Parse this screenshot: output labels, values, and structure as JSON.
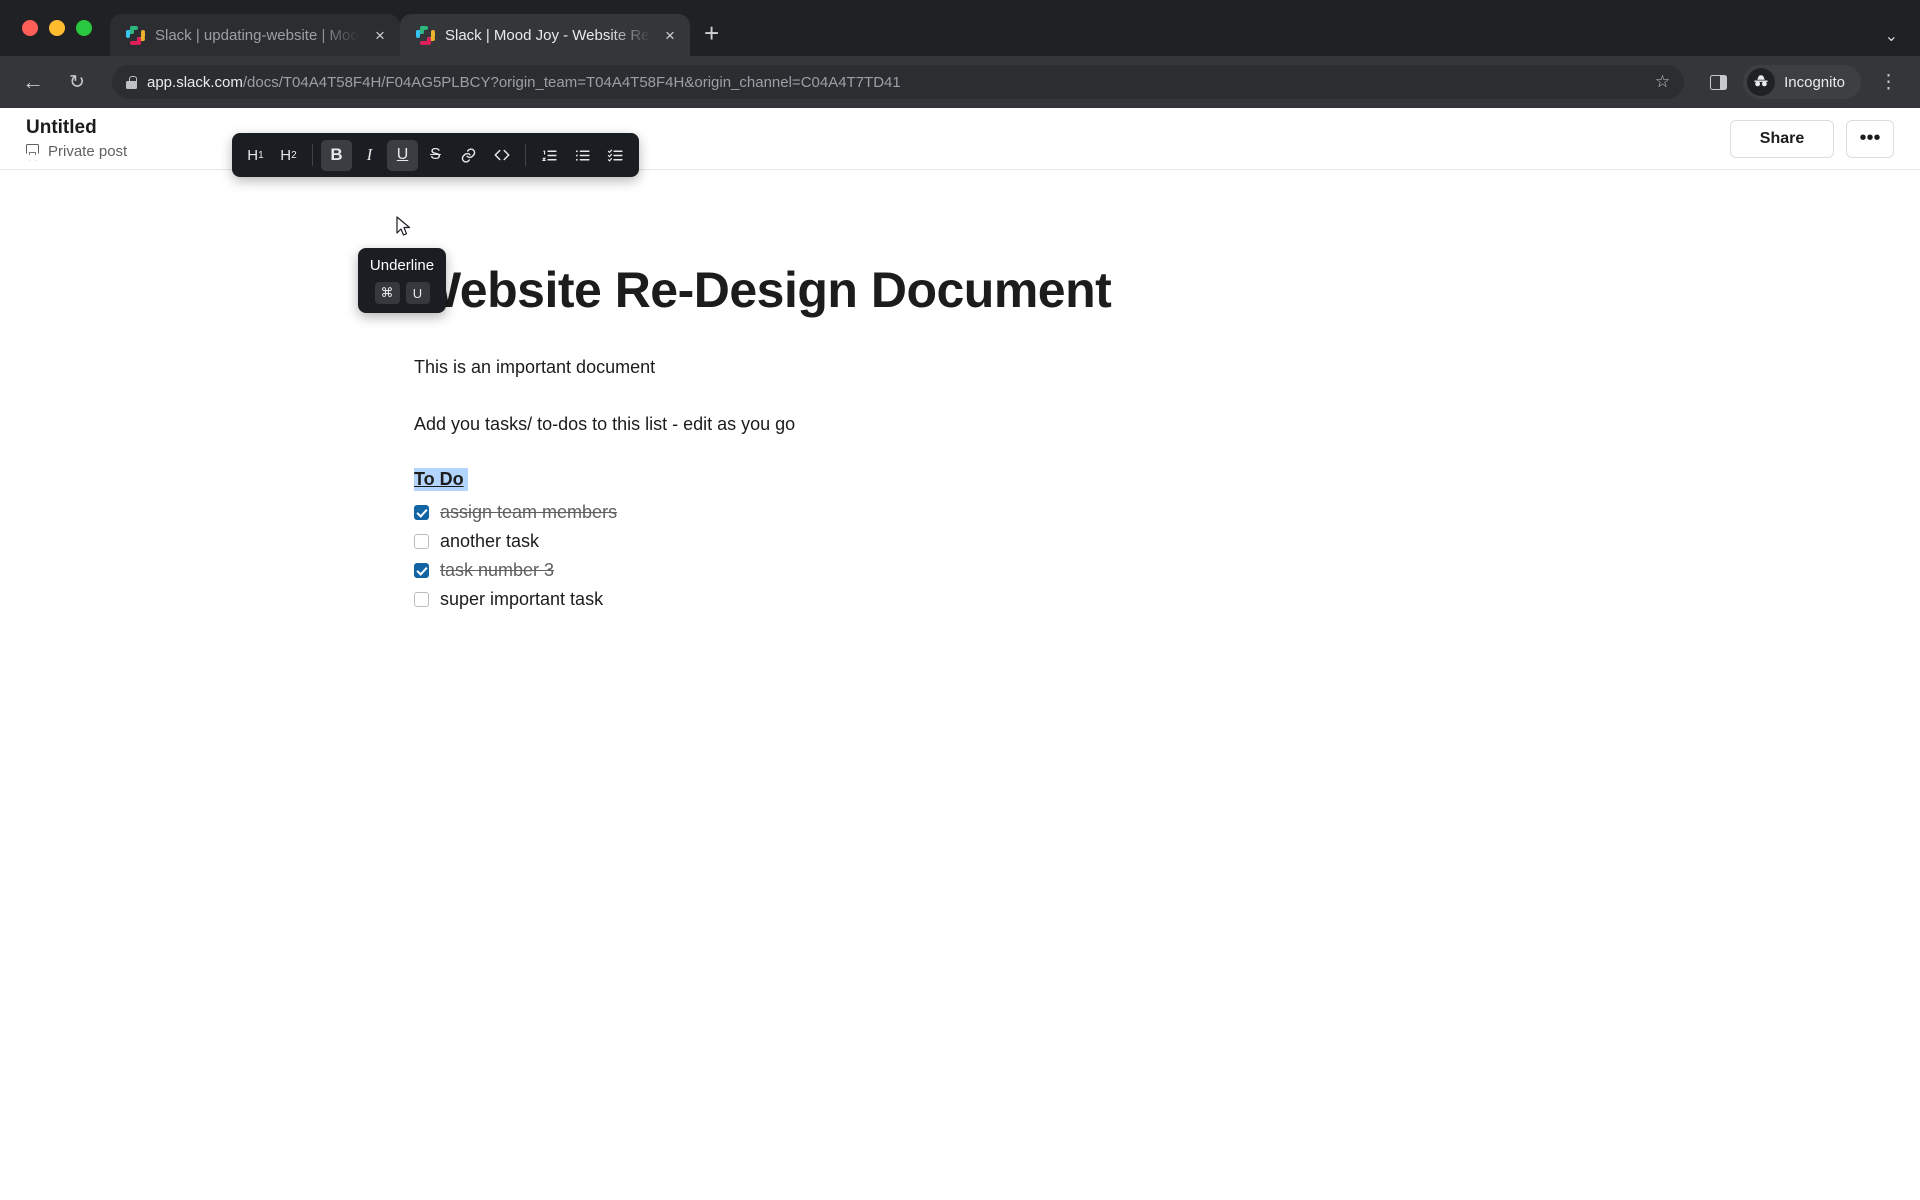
{
  "browser": {
    "tabs": [
      {
        "title": "Slack | updating-website | Mood Joy",
        "active": false,
        "icon": "slack-icon",
        "close_label": "×"
      },
      {
        "title": "Slack | Mood Joy - Website Re-Design Document",
        "active": true,
        "icon": "slack-icon",
        "close_label": "×"
      }
    ],
    "new_tab_label": "+",
    "tab_list_chevron": "⌄",
    "nav": {
      "back": "←",
      "forward": "→",
      "reload": "↻"
    },
    "omnibox": {
      "lock_icon": "lock-icon",
      "url_host": "app.slack.com",
      "url_rest": "/docs/T04A4T58F4H/F04AG5PLBCY?origin_team=T04A4T58F4H&origin_channel=C04A4T7TD41",
      "bookmark_star": "☆"
    },
    "side_panel_icon": "side-panel-icon",
    "profile": {
      "label": "Incognito",
      "avatar_icon": "incognito-hat-icon"
    },
    "chrome_menu": "⋮"
  },
  "doc_header": {
    "title": "Untitled",
    "visibility": "Private post",
    "bookmark_icon": "bookmark-icon",
    "share_label": "Share",
    "more_label": "•••"
  },
  "format_toolbar": {
    "items": [
      {
        "name": "heading-1-button",
        "label": "H",
        "sub": "1",
        "style": "plain",
        "active": false
      },
      {
        "name": "heading-2-button",
        "label": "H",
        "sub": "2",
        "style": "plain",
        "active": false
      },
      {
        "name": "bold-button",
        "label": "B",
        "sub": "",
        "style": "bold",
        "active": true
      },
      {
        "name": "italic-button",
        "label": "I",
        "sub": "",
        "style": "italic",
        "active": false
      },
      {
        "name": "underline-button",
        "label": "U",
        "sub": "",
        "style": "underline",
        "active": true
      },
      {
        "name": "strikethrough-button",
        "label": "S",
        "sub": "",
        "style": "strike",
        "active": false
      },
      {
        "name": "link-button",
        "label": "🔗",
        "sub": "",
        "style": "icon",
        "active": false
      },
      {
        "name": "code-button",
        "label": "</>",
        "sub": "",
        "style": "icon",
        "active": false
      },
      {
        "name": "ordered-list-button",
        "label": "list-ordered-icon",
        "sub": "",
        "style": "svg",
        "active": false
      },
      {
        "name": "bulleted-list-button",
        "label": "list-bulleted-icon",
        "sub": "",
        "style": "svg",
        "active": false
      },
      {
        "name": "checklist-button",
        "label": "list-checklist-icon",
        "sub": "",
        "style": "svg",
        "active": false
      }
    ]
  },
  "tooltip": {
    "title": "Underline",
    "keys": [
      "⌘",
      "U"
    ]
  },
  "document": {
    "heading": "Website Re-Design Document",
    "paragraphs": [
      "This is an important document",
      "Add you tasks/ to-dos to this list - edit as you go"
    ],
    "todo_heading": "To Do",
    "todos": [
      {
        "label": "assign team members",
        "checked": true
      },
      {
        "label": "another task",
        "checked": false
      },
      {
        "label": "task number 3",
        "checked": true
      },
      {
        "label": "super important task",
        "checked": false
      }
    ]
  },
  "colors": {
    "accent_blue": "#1264a3",
    "selection_blue": "#b3d4fc",
    "toolbar_dark": "#1a1d21",
    "chrome_dark": "#202124",
    "text_primary": "#1d1c1d",
    "text_secondary": "#616061"
  }
}
